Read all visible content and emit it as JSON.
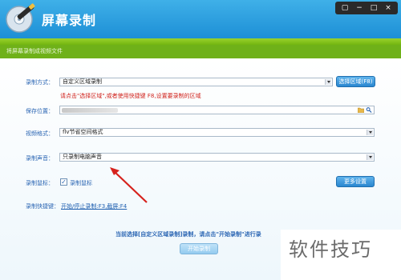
{
  "app": {
    "title": "屏幕录制"
  },
  "window_controls": {
    "restore": "▢",
    "minimize": "−",
    "maximize": "□",
    "close": "×"
  },
  "subtitle": "将屏幕录制成视频文件",
  "form": {
    "record_mode": {
      "label": "录制方式：",
      "value": "自定义区域录制",
      "button": "选择区域(F8)"
    },
    "hint": "请点击\"选择区域\",或者使用快捷键 F8,设置要录制的区域",
    "save_location": {
      "label": "保存位置："
    },
    "video_format": {
      "label": "视频格式：",
      "value": "flv节省空间格式"
    },
    "audio": {
      "label": "录制声音：",
      "value": "只录制电脑声音"
    },
    "cursor": {
      "label": "录制鼠标：",
      "checkbox_label": "录制鼠标",
      "checked": true
    },
    "more_settings": "更多设置",
    "shortcut": {
      "label": "录制快捷键：",
      "link": "开始/停止录制:F3,截屏:F4"
    }
  },
  "status": "当前选择[自定义区域录制]录制，请点击\"开始录制\"进行录",
  "start_button": "开始录制",
  "watermark": "软件技巧",
  "colors": {
    "accent": "#1d8fd6",
    "green": "#6fb119",
    "hint": "#d0231c",
    "arrow": "#d6221d"
  }
}
